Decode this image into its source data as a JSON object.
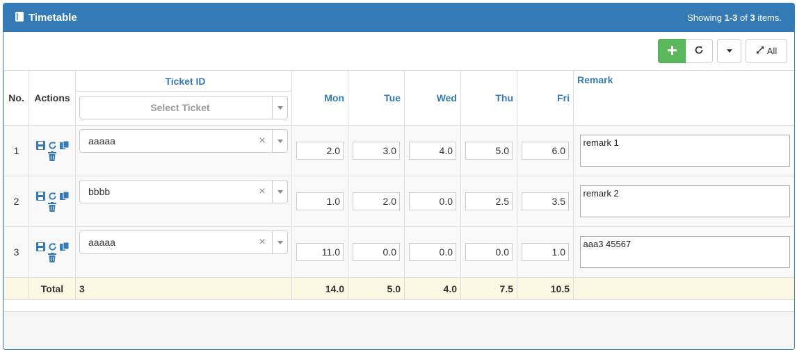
{
  "panel": {
    "title": "Timetable",
    "summary_prefix": "Showing ",
    "summary_range": "1-3",
    "summary_mid": " of ",
    "summary_total": "3",
    "summary_suffix": " items."
  },
  "toolbar": {
    "add_icon": "plus-icon",
    "refresh_icon": "refresh-icon",
    "all_label": "All"
  },
  "columns": {
    "no": "No.",
    "actions": "Actions",
    "ticket": "Ticket ID",
    "ticket_placeholder": "Select Ticket",
    "mon": "Mon",
    "tue": "Tue",
    "wed": "Wed",
    "thu": "Thu",
    "fri": "Fri",
    "remark": "Remark"
  },
  "rows": [
    {
      "no": "1",
      "ticket": "aaaaa",
      "mon": "2.0",
      "tue": "3.0",
      "wed": "4.0",
      "thu": "5.0",
      "fri": "6.0",
      "remark": "remark 1"
    },
    {
      "no": "2",
      "ticket": "bbbb",
      "mon": "1.0",
      "tue": "2.0",
      "wed": "0.0",
      "thu": "2.5",
      "fri": "3.5",
      "remark": "remark 2"
    },
    {
      "no": "3",
      "ticket": "aaaaa",
      "mon": "11.0",
      "tue": "0.0",
      "wed": "0.0",
      "thu": "0.0",
      "fri": "1.0",
      "remark": "aaa3 45567"
    }
  ],
  "totals": {
    "label": "Total",
    "count": "3",
    "mon": "14.0",
    "tue": "5.0",
    "wed": "4.0",
    "thu": "7.5",
    "fri": "10.5"
  },
  "colors": {
    "primary": "#337ab7",
    "success": "#5cb85c",
    "total_row": "#fcf8e3"
  }
}
